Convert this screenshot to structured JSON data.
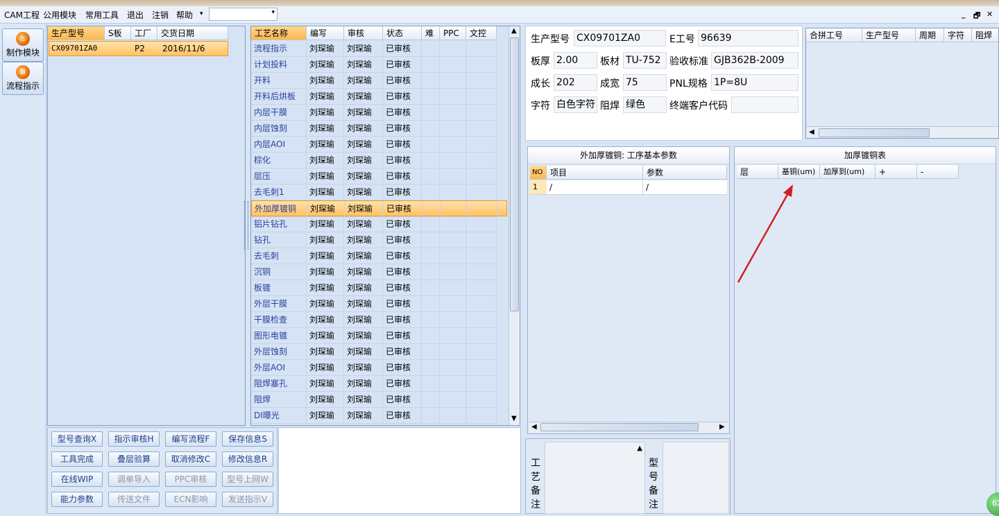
{
  "menu": {
    "items": [
      "CAM工程",
      "公用模块",
      "常用工具",
      "退出",
      "注销",
      "帮助"
    ],
    "combo_value": ""
  },
  "window_controls": {
    "minimize": "_",
    "restore": "🗗",
    "close": "✕"
  },
  "nav": {
    "buttons": [
      {
        "label": "制作模块",
        "icon": "fire-icon"
      },
      {
        "label": "流程指示",
        "icon": "flow-icon"
      }
    ]
  },
  "job_grid": {
    "columns": [
      "生产型号",
      "S板",
      "工厂",
      "交货日期"
    ],
    "rows": [
      {
        "model": "CX09701ZA0",
        "s_board": "",
        "factory": "P2",
        "date": "2016/11/6"
      }
    ]
  },
  "process_grid": {
    "columns": [
      "工艺名称",
      "编写",
      "审核",
      "状态",
      "难",
      "PPC",
      "文控"
    ],
    "selected_index": 10,
    "rows": [
      {
        "name": "流程指示",
        "writer": "刘琛瑜",
        "reviewer": "刘琛瑜",
        "status": "已审核"
      },
      {
        "name": "计划投料",
        "writer": "刘琛瑜",
        "reviewer": "刘琛瑜",
        "status": "已审核"
      },
      {
        "name": "开料",
        "writer": "刘琛瑜",
        "reviewer": "刘琛瑜",
        "status": "已审核"
      },
      {
        "name": "开料后烘板",
        "writer": "刘琛瑜",
        "reviewer": "刘琛瑜",
        "status": "已审核"
      },
      {
        "name": "内层干膜",
        "writer": "刘琛瑜",
        "reviewer": "刘琛瑜",
        "status": "已审核"
      },
      {
        "name": "内层蚀刻",
        "writer": "刘琛瑜",
        "reviewer": "刘琛瑜",
        "status": "已审核"
      },
      {
        "name": "内层AOI",
        "writer": "刘琛瑜",
        "reviewer": "刘琛瑜",
        "status": "已审核"
      },
      {
        "name": "棕化",
        "writer": "刘琛瑜",
        "reviewer": "刘琛瑜",
        "status": "已审核"
      },
      {
        "name": "层压",
        "writer": "刘琛瑜",
        "reviewer": "刘琛瑜",
        "status": "已审核"
      },
      {
        "name": "去毛刺1",
        "writer": "刘琛瑜",
        "reviewer": "刘琛瑜",
        "status": "已审核"
      },
      {
        "name": "外加厚镀铜",
        "writer": "刘琛瑜",
        "reviewer": "刘琛瑜",
        "status": "已审核"
      },
      {
        "name": "铝片钻孔",
        "writer": "刘琛瑜",
        "reviewer": "刘琛瑜",
        "status": "已审核"
      },
      {
        "name": "钻孔",
        "writer": "刘琛瑜",
        "reviewer": "刘琛瑜",
        "status": "已审核"
      },
      {
        "name": "去毛刺",
        "writer": "刘琛瑜",
        "reviewer": "刘琛瑜",
        "status": "已审核"
      },
      {
        "name": "沉铜",
        "writer": "刘琛瑜",
        "reviewer": "刘琛瑜",
        "status": "已审核"
      },
      {
        "name": "板镀",
        "writer": "刘琛瑜",
        "reviewer": "刘琛瑜",
        "status": "已审核"
      },
      {
        "name": "外层干膜",
        "writer": "刘琛瑜",
        "reviewer": "刘琛瑜",
        "status": "已审核"
      },
      {
        "name": "干膜检查",
        "writer": "刘琛瑜",
        "reviewer": "刘琛瑜",
        "status": "已审核"
      },
      {
        "name": "图形电镀",
        "writer": "刘琛瑜",
        "reviewer": "刘琛瑜",
        "status": "已审核"
      },
      {
        "name": "外层蚀刻",
        "writer": "刘琛瑜",
        "reviewer": "刘琛瑜",
        "status": "已审核"
      },
      {
        "name": "外层AOI",
        "writer": "刘琛瑜",
        "reviewer": "刘琛瑜",
        "status": "已审核"
      },
      {
        "name": "阻焊塞孔",
        "writer": "刘琛瑜",
        "reviewer": "刘琛瑜",
        "status": "已审核"
      },
      {
        "name": "阻焊",
        "writer": "刘琛瑜",
        "reviewer": "刘琛瑜",
        "status": "已审核"
      },
      {
        "name": "DI曝光",
        "writer": "刘琛瑜",
        "reviewer": "刘琛瑜",
        "status": "已审核"
      }
    ]
  },
  "actions": {
    "buttons": [
      {
        "label": "型号查询X",
        "enabled": true
      },
      {
        "label": "指示审核H",
        "enabled": true
      },
      {
        "label": "编写流程F",
        "enabled": true
      },
      {
        "label": "保存信息S",
        "enabled": true
      },
      {
        "label": "工具完成",
        "enabled": true
      },
      {
        "label": "叠层验算",
        "enabled": true
      },
      {
        "label": "取消修改C",
        "enabled": true
      },
      {
        "label": "修改信息R",
        "enabled": true
      },
      {
        "label": "在线WIP",
        "enabled": true
      },
      {
        "label": "调单导入",
        "enabled": false
      },
      {
        "label": "PPC审核",
        "enabled": false
      },
      {
        "label": "型号上网W",
        "enabled": false
      },
      {
        "label": "能力参数",
        "enabled": true
      },
      {
        "label": "传送文件",
        "enabled": false
      },
      {
        "label": "ECN影响",
        "enabled": false
      },
      {
        "label": "发送指示V",
        "enabled": false
      }
    ]
  },
  "info": {
    "model_label": "生产型号",
    "model": "CX09701ZA0",
    "e_no_label": "E工号",
    "e_no": "96639",
    "thickness_label": "板厚",
    "thickness": "2.00",
    "material_label": "板材",
    "material": "TU-752",
    "standard_label": "验收标准",
    "standard": "GJB362B-2009",
    "length_label": "成长",
    "length": "202",
    "width_label": "成宽",
    "width": "75",
    "pnl_label": "PNL规格",
    "pnl": "1P=8U",
    "silk_label": "字符",
    "silk": "白色字符",
    "mask_label": "阻焊",
    "mask": "绿色",
    "customer_label": "终端客户代码",
    "customer": ""
  },
  "merge_grid": {
    "columns": [
      "合拼工号",
      "生产型号",
      "周期",
      "字符",
      "阻焊"
    ]
  },
  "param_panel": {
    "title": "外加厚镀铜: 工序基本参数",
    "columns": [
      "NO",
      "项目",
      "参数"
    ],
    "rows": [
      {
        "no": "1",
        "item": "/",
        "param": "/"
      }
    ]
  },
  "plating_panel": {
    "title": "加厚镀铜表",
    "columns": [
      "层",
      "基铜(um)",
      "加厚到(um)",
      "+",
      "-"
    ]
  },
  "remarks": {
    "process_label": "工艺备注",
    "model_label": "型号备注"
  },
  "status": {
    "badge": "62"
  }
}
